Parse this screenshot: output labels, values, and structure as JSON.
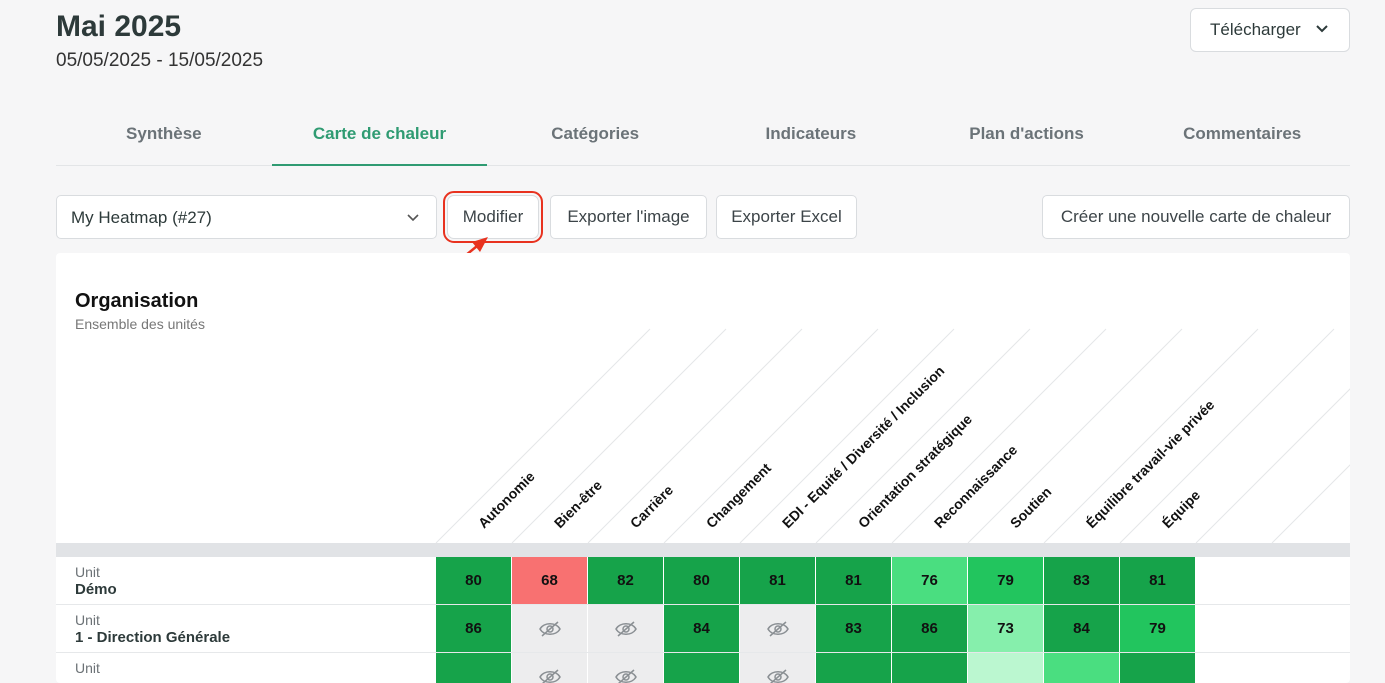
{
  "header": {
    "title": "Mai 2025",
    "daterange": "05/05/2025 - 15/05/2025",
    "download_label": "Télécharger"
  },
  "tabs": [
    {
      "label": "Synthèse",
      "active": false
    },
    {
      "label": "Carte de chaleur",
      "active": true
    },
    {
      "label": "Catégories",
      "active": false
    },
    {
      "label": "Indicateurs",
      "active": false
    },
    {
      "label": "Plan d'actions",
      "active": false
    },
    {
      "label": "Commentaires",
      "active": false
    }
  ],
  "toolbar": {
    "heatmap_select": "My Heatmap (#27)",
    "modify_label": "Modifier",
    "export_image_label": "Exporter l'image",
    "export_excel_label": "Exporter Excel",
    "create_label": "Créer une nouvelle carte de chaleur"
  },
  "heatmap": {
    "org_title": "Organisation",
    "org_subtitle": "Ensemble des unités",
    "columns": [
      "Autonomie",
      "Bien-être",
      "Carrière",
      "Changement",
      "EDI - Equité / Diversité / Inclusion",
      "Orientation stratégique",
      "Reconnaissance",
      "Soutien",
      "Équilibre travail-vie privée",
      "Équipe"
    ],
    "rows": [
      {
        "type": "Unit",
        "name": "Démo",
        "values": [
          "80",
          "68",
          "82",
          "80",
          "81",
          "81",
          "76",
          "79",
          "83",
          "81"
        ],
        "shades": [
          "g1",
          "red",
          "g1",
          "g1",
          "g1",
          "g1",
          "g3",
          "g2",
          "g1",
          "g1"
        ]
      },
      {
        "type": "Unit",
        "name": "1 - Direction Générale",
        "values": [
          "86",
          "",
          "",
          "84",
          "",
          "83",
          "86",
          "73",
          "84",
          "79"
        ],
        "shades": [
          "g1",
          "hid",
          "hid",
          "g1",
          "hid",
          "g1",
          "g1",
          "g4",
          "g1",
          "g2"
        ]
      },
      {
        "type": "Unit",
        "name": "",
        "values": [
          "",
          "",
          "",
          "",
          "",
          "",
          "",
          "",
          "",
          ""
        ],
        "shades": [
          "g1",
          "hid",
          "hid",
          "g1",
          "hid",
          "g1",
          "g1",
          "g5",
          "g3",
          "g1"
        ]
      }
    ]
  },
  "colors": {
    "accent": "#2f9b72",
    "highlight": "#e8321f",
    "dark_green": "#16a34a",
    "red": "#f87171"
  }
}
